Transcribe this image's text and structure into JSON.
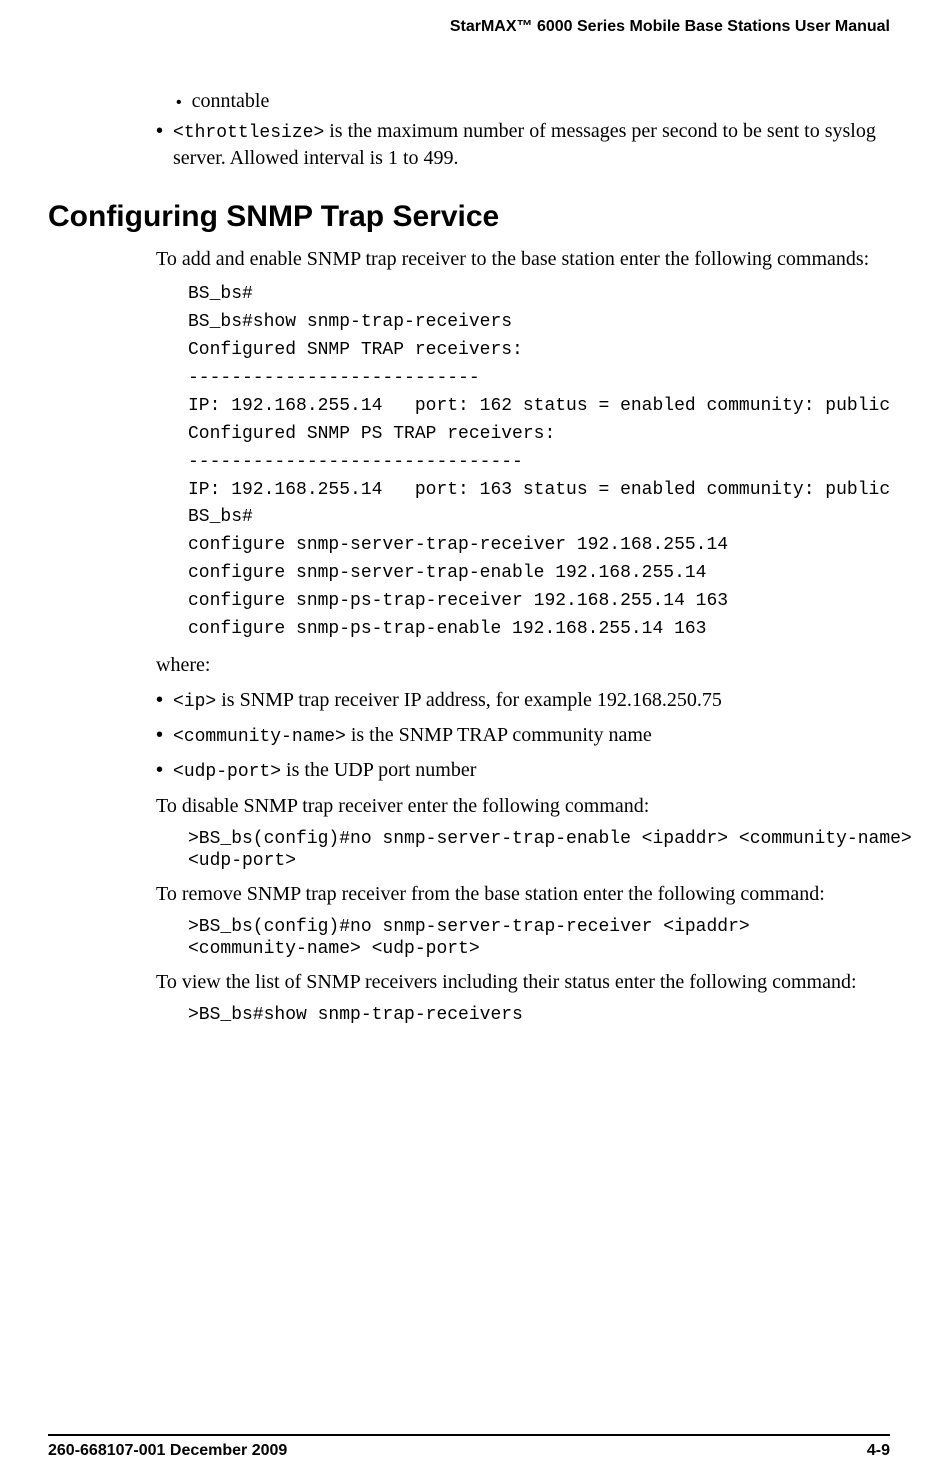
{
  "header": {
    "title": "StarMAX™ 6000 Series Mobile Base Stations User Manual"
  },
  "top": {
    "conntable": "conntable",
    "throttlesize_code": "<throttlesize>",
    "throttlesize_rest": " is the maximum number of messages per second to be sent to syslog server. Allowed interval is 1 to 499."
  },
  "section_heading": "Configuring SNMP Trap Service",
  "intro": "To add and enable SNMP trap receiver to the base station enter the following commands:",
  "code1": "BS_bs#\nBS_bs#show snmp-trap-receivers\nConfigured SNMP TRAP receivers:\n---------------------------\nIP: 192.168.255.14   port: 162 status = enabled community: public\nConfigured SNMP PS TRAP receivers:\n-------------------------------\nIP: 192.168.255.14   port: 163 status = enabled community: public\nBS_bs#\nconfigure snmp-server-trap-receiver 192.168.255.14\nconfigure snmp-server-trap-enable 192.168.255.14\nconfigure snmp-ps-trap-receiver 192.168.255.14 163\nconfigure snmp-ps-trap-enable 192.168.255.14 163",
  "where_label": "where:",
  "where_items": [
    {
      "code": "<ip>",
      "rest": " is SNMP trap receiver IP address, for example 192.168.250.75"
    },
    {
      "code": "<community-name>",
      "rest": " is the SNMP TRAP community name"
    },
    {
      "code": "<udp-port>",
      "rest": " is the UDP port number"
    }
  ],
  "disable_para": "To disable SNMP trap receiver enter the following command:",
  "code2": ">BS_bs(config)#no snmp-server-trap-enable <ipaddr> <community-name>\n<udp-port>",
  "remove_para": "To remove SNMP trap receiver from the base station enter the following command:",
  "code3": ">BS_bs(config)#no snmp-server-trap-receiver <ipaddr>\n<community-name> <udp-port>",
  "view_para": "To view the list of SNMP receivers including their status enter the following command:",
  "code4": ">BS_bs#show snmp-trap-receivers",
  "footer": {
    "left": "260-668107-001 December 2009",
    "right": "4-9"
  }
}
